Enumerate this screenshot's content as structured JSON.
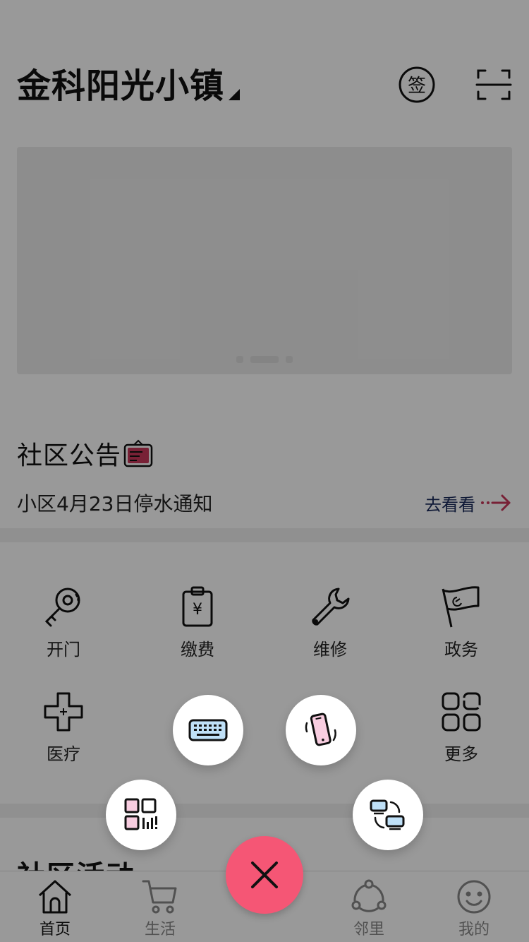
{
  "header": {
    "community_name": "金科阳光小镇",
    "sign_in_glyph": "签",
    "icons": {
      "sign_in": "sign-in-icon",
      "scan": "scan-icon"
    }
  },
  "banner": {
    "slides": 3,
    "active_slide": 2
  },
  "notice": {
    "section_title": "社区公告",
    "text": "小区4月23日停水通知",
    "link_label": "去看看",
    "accent_color": "#c8375a"
  },
  "services": [
    {
      "label": "开门",
      "icon": "key-icon"
    },
    {
      "label": "缴费",
      "icon": "payment-icon"
    },
    {
      "label": "维修",
      "icon": "wrench-icon"
    },
    {
      "label": "政务",
      "icon": "flag-icon"
    },
    {
      "label": "医疗",
      "icon": "medical-cross-icon"
    },
    {
      "label": "更多",
      "icon": "grid-more-icon"
    }
  ],
  "activity": {
    "section_title": "社区活动"
  },
  "tabbar": {
    "items": [
      {
        "label": "首页",
        "icon": "home-icon",
        "active": true
      },
      {
        "label": "生活",
        "icon": "cart-icon",
        "active": false
      },
      {
        "label": "邻里",
        "icon": "share-icon",
        "active": false
      },
      {
        "label": "我的",
        "icon": "smile-icon",
        "active": false
      }
    ]
  },
  "fab_menu": {
    "open": true,
    "close_color": "#f55675",
    "actions": [
      {
        "icon": "keyboard-icon"
      },
      {
        "icon": "phone-shake-icon"
      },
      {
        "icon": "qr-code-icon"
      },
      {
        "icon": "device-switch-icon"
      }
    ]
  }
}
